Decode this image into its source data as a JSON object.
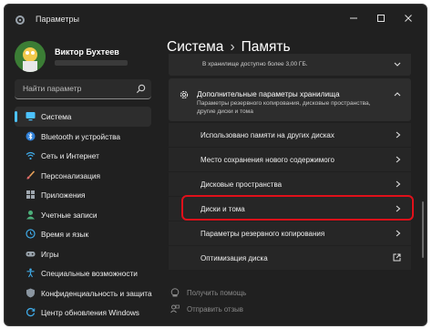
{
  "window": {
    "title": "Параметры",
    "controls": [
      "minimize-icon",
      "maximize-icon",
      "close-icon"
    ]
  },
  "profile": {
    "name": "Виктор Бухтеев"
  },
  "search": {
    "placeholder": "Найти параметр",
    "icon": "search-icon"
  },
  "sidebar": {
    "items": [
      {
        "label": "Система",
        "icon": "monitor-icon",
        "active": true
      },
      {
        "label": "Bluetooth и устройства",
        "icon": "bluetooth-icon"
      },
      {
        "label": "Сеть и Интернет",
        "icon": "wifi-icon"
      },
      {
        "label": "Персонализация",
        "icon": "brush-icon"
      },
      {
        "label": "Приложения",
        "icon": "apps-icon"
      },
      {
        "label": "Учетные записи",
        "icon": "user-icon"
      },
      {
        "label": "Время и язык",
        "icon": "globe-clock-icon"
      },
      {
        "label": "Игры",
        "icon": "gamepad-icon"
      },
      {
        "label": "Специальные возможности",
        "icon": "accessibility-icon"
      },
      {
        "label": "Конфиденциальность и защита",
        "icon": "shield-icon"
      },
      {
        "label": "Центр обновления Windows",
        "icon": "update-icon"
      }
    ]
  },
  "main": {
    "breadcrumb": {
      "parent": "Система",
      "separator": "›",
      "current": "Память"
    },
    "storage_note": "В хранилище доступно более 3,00 ГБ.",
    "advanced": {
      "title": "Дополнительные параметры хранилища",
      "description": "Параметры резервного копирования, дисковые пространства, другие диски и тома"
    },
    "sub_items": [
      {
        "label": "Использовано памяти на других дисках",
        "icon": "chevron-right-icon"
      },
      {
        "label": "Место сохранения нового содержимого",
        "icon": "chevron-right-icon"
      },
      {
        "label": "Дисковые пространства",
        "icon": "chevron-right-icon"
      },
      {
        "label": "Диски и тома",
        "icon": "chevron-right-icon",
        "highlighted": true
      },
      {
        "label": "Параметры резервного копирования",
        "icon": "chevron-right-icon"
      },
      {
        "label": "Оптимизация диска",
        "icon": "external-link-icon"
      }
    ],
    "help": [
      {
        "label": "Получить помощь",
        "icon": "help-icon"
      },
      {
        "label": "Отправить отзыв",
        "icon": "feedback-icon"
      }
    ]
  },
  "colors": {
    "accent": "#4cc2ff",
    "highlight": "#e0101a",
    "background": "#202020"
  }
}
